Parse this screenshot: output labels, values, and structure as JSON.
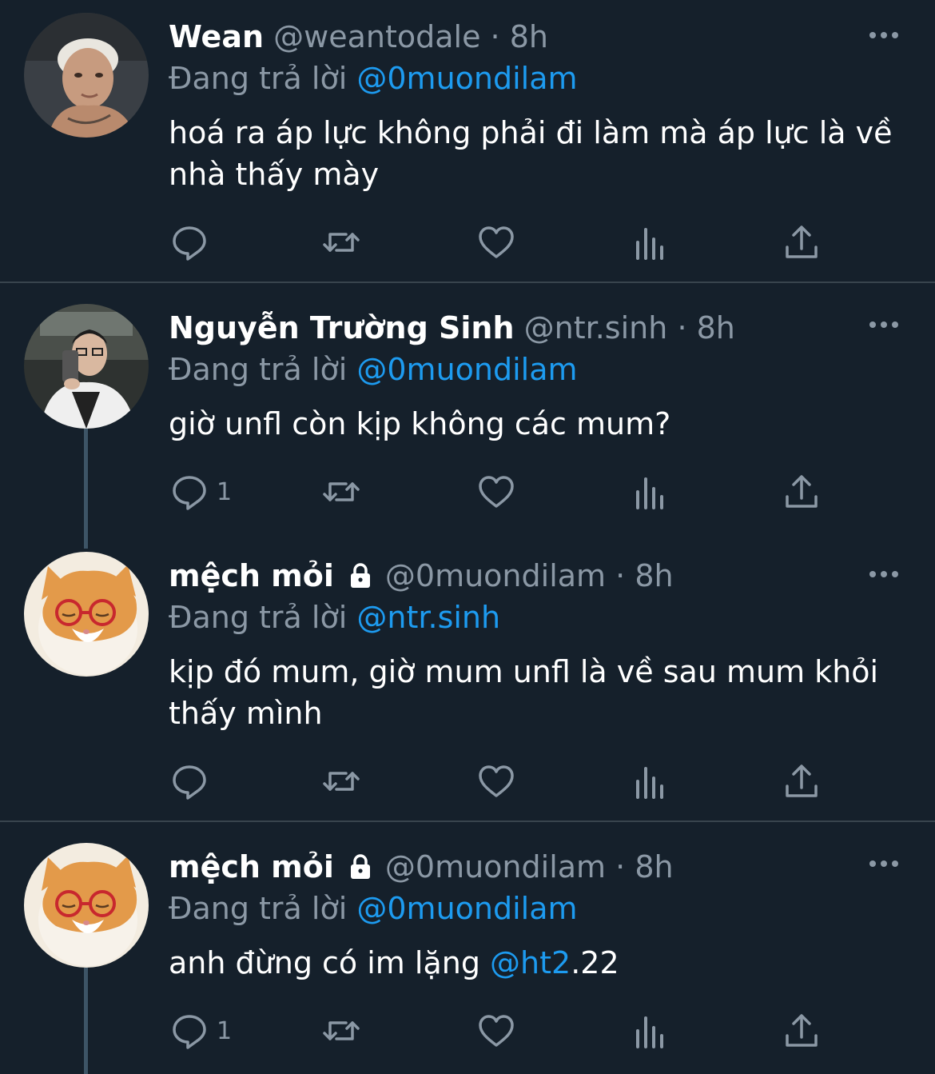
{
  "colors": {
    "background": "#15202b",
    "mention": "#1d9bf0",
    "muted": "#8b98a5",
    "divider": "#38444d"
  },
  "tweets": [
    {
      "name": "Wean",
      "handle": "@weantodale",
      "dot": "·",
      "time": "8h",
      "locked": false,
      "replying_prefix": "Đang trả lời",
      "replying_to": "@0muondilam",
      "text": "hoá ra áp lực không phải đi làm mà áp lực là về nhà thấy mày",
      "reply_count": ""
    },
    {
      "name": "Nguyễn Trường Sinh",
      "handle": "@ntr.sinh",
      "dot": "·",
      "time": "8h",
      "locked": false,
      "replying_prefix": "Đang trả lời",
      "replying_to": "@0muondilam",
      "text": "giờ unfl còn kịp không các mum?",
      "reply_count": "1"
    },
    {
      "name": "mệch mỏi",
      "handle": "@0muondilam",
      "dot": "·",
      "time": "8h",
      "locked": true,
      "replying_prefix": "Đang trả lời",
      "replying_to": "@ntr.sinh",
      "text": "kịp đó mum, giờ mum unfl là về sau mum khỏi thấy mình",
      "reply_count": ""
    },
    {
      "name": "mệch mỏi",
      "handle": "@0muondilam",
      "dot": "·",
      "time": "8h",
      "locked": true,
      "replying_prefix": "Đang trả lời",
      "replying_to": "@0muondilam",
      "text_before": "anh đừng có im lặng ",
      "text_mention": "@ht2",
      "text_after": ".22",
      "reply_count": "1"
    }
  ],
  "icons": [
    "reply-icon",
    "retweet-icon",
    "like-icon",
    "analytics-icon",
    "share-icon",
    "more-icon",
    "lock-icon"
  ]
}
